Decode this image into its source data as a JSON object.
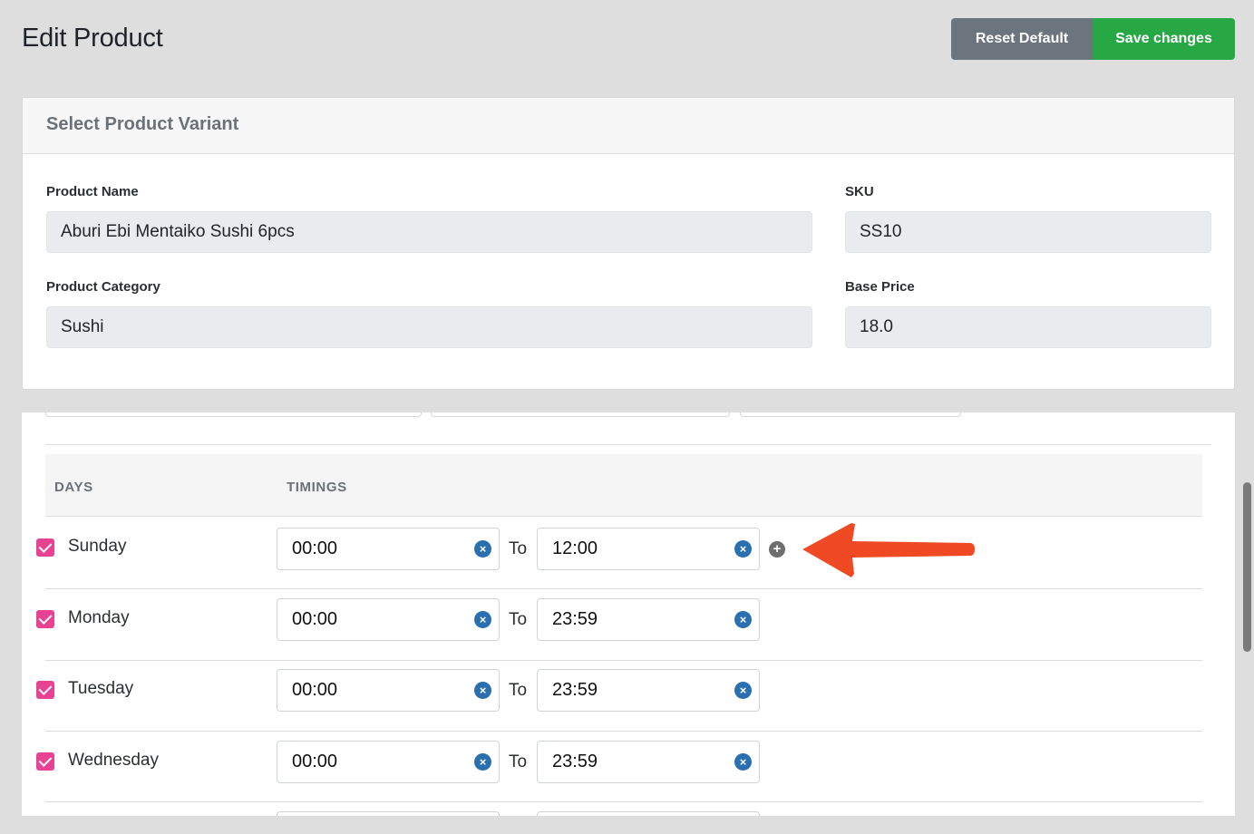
{
  "header": {
    "title": "Edit Product",
    "reset_label": "Reset Default",
    "save_label": "Save changes"
  },
  "variant_card": {
    "title": "Select Product Variant",
    "product_name_label": "Product Name",
    "product_name_value": "Aburi Ebi Mentaiko Sushi 6pcs",
    "sku_label": "SKU",
    "sku_value": "SS10",
    "category_label": "Product Category",
    "category_value": "Sushi",
    "base_price_label": "Base Price",
    "base_price_value": "18.0"
  },
  "schedule": {
    "days_header": "DAYS",
    "timings_header": "TIMINGS",
    "to_label": "To",
    "rows": [
      {
        "day": "Sunday",
        "checked": true,
        "from": "00:00",
        "to": "12:00"
      },
      {
        "day": "Monday",
        "checked": true,
        "from": "00:00",
        "to": "23:59"
      },
      {
        "day": "Tuesday",
        "checked": true,
        "from": "00:00",
        "to": "23:59"
      },
      {
        "day": "Wednesday",
        "checked": true,
        "from": "00:00",
        "to": "23:59"
      }
    ],
    "clear_icon": "×",
    "add_icon": "+"
  },
  "colors": {
    "save": "#28a745",
    "reset": "#6c757d",
    "checkbox": "#e84393",
    "clear_button": "#2a6fb0",
    "annotation_arrow": "#f04a25"
  }
}
